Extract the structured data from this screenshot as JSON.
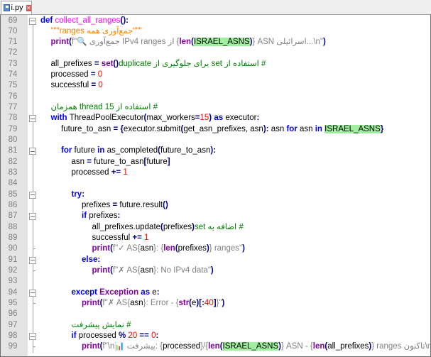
{
  "tab": {
    "filename": "i.py"
  },
  "colors": {
    "keyword": "#0000ff",
    "builtin": "#8000a0",
    "function": "#ff00ff",
    "string": "#808080",
    "docstring": "#ff8000",
    "number": "#ff0000",
    "comment": "#008000",
    "highlight": "#9ef09e"
  },
  "lines": [
    {
      "n": "69",
      "indent": 0,
      "fold": "box",
      "tokens": [
        [
          "def ",
          "k"
        ],
        [
          "collect_all_ranges",
          "f"
        ],
        [
          "():",
          "o"
        ]
      ]
    },
    {
      "n": "70",
      "indent": 1,
      "fold": "line",
      "tokens": [
        [
          "\"\"\"جمع‌آوری همه ranges\"\"\"",
          "d"
        ]
      ]
    },
    {
      "n": "71",
      "indent": 1,
      "fold": "line",
      "tokens": [
        [
          "print",
          "b"
        ],
        [
          "(",
          "o"
        ],
        [
          "f\"🔍 جمع‌آوری IPv4 ranges از {",
          "s"
        ],
        [
          "len",
          "b"
        ],
        [
          "(",
          "o"
        ],
        [
          "ISRAEL_ASNS",
          "h"
        ],
        [
          ")",
          "o"
        ],
        [
          "} ASN اسرائیلی...\\n\"",
          "s"
        ],
        [
          ")",
          "o"
        ]
      ]
    },
    {
      "n": "72",
      "indent": 0,
      "fold": "line",
      "tokens": []
    },
    {
      "n": "73",
      "indent": 1,
      "fold": "line",
      "tokens": [
        [
          "all_prefixes ",
          "p"
        ],
        [
          "= ",
          "o"
        ],
        [
          "set",
          "b"
        ],
        [
          "()",
          "o"
        ],
        [
          "  # استفاده از set برای جلوگیری از duplicate",
          "c"
        ]
      ]
    },
    {
      "n": "74",
      "indent": 1,
      "fold": "line",
      "tokens": [
        [
          "processed ",
          "p"
        ],
        [
          "= ",
          "o"
        ],
        [
          "0",
          "n"
        ]
      ]
    },
    {
      "n": "75",
      "indent": 1,
      "fold": "line",
      "tokens": [
        [
          "successful ",
          "p"
        ],
        [
          "= ",
          "o"
        ],
        [
          "0",
          "n"
        ]
      ]
    },
    {
      "n": "76",
      "indent": 0,
      "fold": "line",
      "tokens": []
    },
    {
      "n": "77",
      "indent": 1,
      "fold": "line",
      "tokens": [
        [
          "# استفاده از 15 thread همزمان",
          "c"
        ]
      ]
    },
    {
      "n": "78",
      "indent": 1,
      "fold": "box",
      "tokens": [
        [
          "with ",
          "k"
        ],
        [
          "ThreadPoolExecutor",
          "p"
        ],
        [
          "(",
          "o"
        ],
        [
          "max_workers",
          "p"
        ],
        [
          "=",
          "o"
        ],
        [
          "15",
          "n"
        ],
        [
          ") ",
          "o"
        ],
        [
          "as ",
          "k"
        ],
        [
          "executor",
          "p"
        ],
        [
          ":",
          "o"
        ]
      ]
    },
    {
      "n": "79",
      "indent": 2,
      "fold": "line",
      "tokens": [
        [
          "future_to_asn ",
          "p"
        ],
        [
          "= {",
          "o"
        ],
        [
          "executor.submit",
          "p"
        ],
        [
          "(",
          "o"
        ],
        [
          "get_asn_prefixes, asn",
          "p"
        ],
        [
          "): ",
          "o"
        ],
        [
          "asn ",
          "p"
        ],
        [
          "for ",
          "k"
        ],
        [
          "asn ",
          "p"
        ],
        [
          "in ",
          "k"
        ],
        [
          "ISRAEL_ASNS",
          "h"
        ],
        [
          "}",
          "o"
        ]
      ]
    },
    {
      "n": "80",
      "indent": 0,
      "fold": "line",
      "tokens": []
    },
    {
      "n": "81",
      "indent": 2,
      "fold": "box",
      "tokens": [
        [
          "for ",
          "k"
        ],
        [
          "future ",
          "p"
        ],
        [
          "in ",
          "k"
        ],
        [
          "as_completed",
          "p"
        ],
        [
          "(",
          "o"
        ],
        [
          "future_to_asn",
          "p"
        ],
        [
          "):",
          "o"
        ]
      ]
    },
    {
      "n": "82",
      "indent": 3,
      "fold": "line",
      "tokens": [
        [
          "asn ",
          "p"
        ],
        [
          "= ",
          "o"
        ],
        [
          "future_to_asn",
          "p"
        ],
        [
          "[",
          "o"
        ],
        [
          "future",
          "p"
        ],
        [
          "]",
          "o"
        ]
      ]
    },
    {
      "n": "83",
      "indent": 3,
      "fold": "line",
      "tokens": [
        [
          "processed ",
          "p"
        ],
        [
          "+= ",
          "o"
        ],
        [
          "1",
          "n"
        ]
      ]
    },
    {
      "n": "84",
      "indent": 0,
      "fold": "line",
      "tokens": []
    },
    {
      "n": "85",
      "indent": 3,
      "fold": "box",
      "tokens": [
        [
          "try",
          "k"
        ],
        [
          ":",
          "o"
        ]
      ]
    },
    {
      "n": "86",
      "indent": 4,
      "fold": "line",
      "tokens": [
        [
          "prefixes ",
          "p"
        ],
        [
          "= ",
          "o"
        ],
        [
          "future.result",
          "p"
        ],
        [
          "()",
          "o"
        ]
      ]
    },
    {
      "n": "87",
      "indent": 4,
      "fold": "box",
      "tokens": [
        [
          "if ",
          "k"
        ],
        [
          "prefixes",
          "p"
        ],
        [
          ":",
          "o"
        ]
      ]
    },
    {
      "n": "88",
      "indent": 5,
      "fold": "line",
      "tokens": [
        [
          "all_prefixes.update",
          "p"
        ],
        [
          "(",
          "o"
        ],
        [
          "prefixes",
          "p"
        ],
        [
          ")",
          "o"
        ],
        [
          "  # اضافه به set",
          "c"
        ]
      ]
    },
    {
      "n": "89",
      "indent": 5,
      "fold": "line",
      "tokens": [
        [
          "successful ",
          "p"
        ],
        [
          "+= ",
          "o"
        ],
        [
          "1",
          "n"
        ]
      ]
    },
    {
      "n": "90",
      "indent": 5,
      "fold": "tick",
      "tokens": [
        [
          "print",
          "b"
        ],
        [
          "(",
          "o"
        ],
        [
          "f\"✓ AS{",
          "s"
        ],
        [
          "asn",
          "p"
        ],
        [
          "}: {",
          "s"
        ],
        [
          "len",
          "b"
        ],
        [
          "(",
          "o"
        ],
        [
          "prefixes",
          "p"
        ],
        [
          ")",
          "o"
        ],
        [
          "} ranges\"",
          "s"
        ],
        [
          ")",
          "o"
        ]
      ]
    },
    {
      "n": "91",
      "indent": 4,
      "fold": "box",
      "tokens": [
        [
          "else",
          "k"
        ],
        [
          ":",
          "o"
        ]
      ]
    },
    {
      "n": "92",
      "indent": 5,
      "fold": "tick",
      "tokens": [
        [
          "print",
          "b"
        ],
        [
          "(",
          "o"
        ],
        [
          "f\"✗ AS{",
          "s"
        ],
        [
          "asn",
          "p"
        ],
        [
          "}: No IPv4 data\"",
          "s"
        ],
        [
          ")",
          "o"
        ]
      ]
    },
    {
      "n": "93",
      "indent": 0,
      "fold": "line",
      "tokens": []
    },
    {
      "n": "94",
      "indent": 3,
      "fold": "box",
      "tokens": [
        [
          "except ",
          "k"
        ],
        [
          "Exception ",
          "b"
        ],
        [
          "as ",
          "k"
        ],
        [
          "e",
          "p"
        ],
        [
          ":",
          "o"
        ]
      ]
    },
    {
      "n": "95",
      "indent": 4,
      "fold": "tick",
      "tokens": [
        [
          "print",
          "b"
        ],
        [
          "(",
          "o"
        ],
        [
          "f\"✗ AS{",
          "s"
        ],
        [
          "asn",
          "p"
        ],
        [
          "}: Error - {",
          "s"
        ],
        [
          "str",
          "b"
        ],
        [
          "(",
          "o"
        ],
        [
          "e",
          "p"
        ],
        [
          ")[:",
          "o"
        ],
        [
          "40",
          "n"
        ],
        [
          "]",
          "o"
        ],
        [
          "}\"",
          "s"
        ],
        [
          ")",
          "o"
        ]
      ]
    },
    {
      "n": "96",
      "indent": 0,
      "fold": "line",
      "tokens": []
    },
    {
      "n": "97",
      "indent": 3,
      "fold": "line",
      "tokens": [
        [
          "# نمایش پیشرفت",
          "c"
        ]
      ]
    },
    {
      "n": "98",
      "indent": 3,
      "fold": "box",
      "tokens": [
        [
          "if ",
          "k"
        ],
        [
          "processed ",
          "p"
        ],
        [
          "% ",
          "o"
        ],
        [
          "20 ",
          "n"
        ],
        [
          "== ",
          "o"
        ],
        [
          "0",
          "n"
        ],
        [
          ":",
          "o"
        ]
      ]
    },
    {
      "n": "99",
      "indent": 4,
      "fold": "tick",
      "tokens": [
        [
          "print",
          "b"
        ],
        [
          "(",
          "o"
        ],
        [
          "f\"\\n📊 پیشرفت: {",
          "s"
        ],
        [
          "processed",
          "p"
        ],
        [
          "}/{",
          "s"
        ],
        [
          "len",
          "b"
        ],
        [
          "(",
          "o"
        ],
        [
          "ISRAEL_ASNS",
          "h"
        ],
        [
          ")",
          "o"
        ],
        [
          "} ASN - {",
          "s"
        ],
        [
          "len",
          "b"
        ],
        [
          "(",
          "o"
        ],
        [
          "all_prefixes",
          "p"
        ],
        [
          ")",
          "o"
        ],
        [
          "} ranges تاکنون\\n\"",
          "s"
        ],
        [
          ")",
          "o"
        ]
      ]
    }
  ]
}
